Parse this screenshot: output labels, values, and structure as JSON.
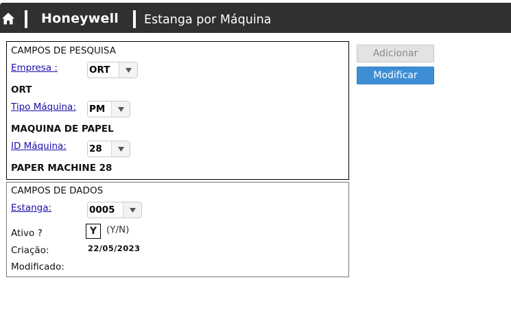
{
  "header": {
    "home_icon": "home-icon",
    "brand": "Honeywell",
    "title": "Estanga por Máquina"
  },
  "search_panel": {
    "title": "CAMPOS DE PESQUISA",
    "empresa": {
      "label": "Empresa :",
      "value": "ORT",
      "description": "ORT"
    },
    "tipo_maquina": {
      "label": "Tipo Máquina:",
      "value": "PM",
      "description": "MAQUINA DE PAPEL"
    },
    "id_maquina": {
      "label": "ID Máquina:",
      "value": "28",
      "description": "PAPER MACHINE 28"
    }
  },
  "data_panel": {
    "title": "CAMPOS DE DADOS",
    "estanga": {
      "label": "Estanga:",
      "value": "0005"
    },
    "ativo": {
      "label": "Ativo ?",
      "value": "Y",
      "hint": "(Y/N)"
    },
    "criacao": {
      "label": "Criação:",
      "value": "22/05/2023"
    },
    "modificado": {
      "label": "Modificado:",
      "value": ""
    }
  },
  "buttons": {
    "add": "Adicionar",
    "modify": "Modificar"
  },
  "colors": {
    "header_bg": "#303030",
    "primary_button": "#3d8ed4",
    "disabled_button": "#e3e3e3",
    "link": "#1a0dab"
  }
}
